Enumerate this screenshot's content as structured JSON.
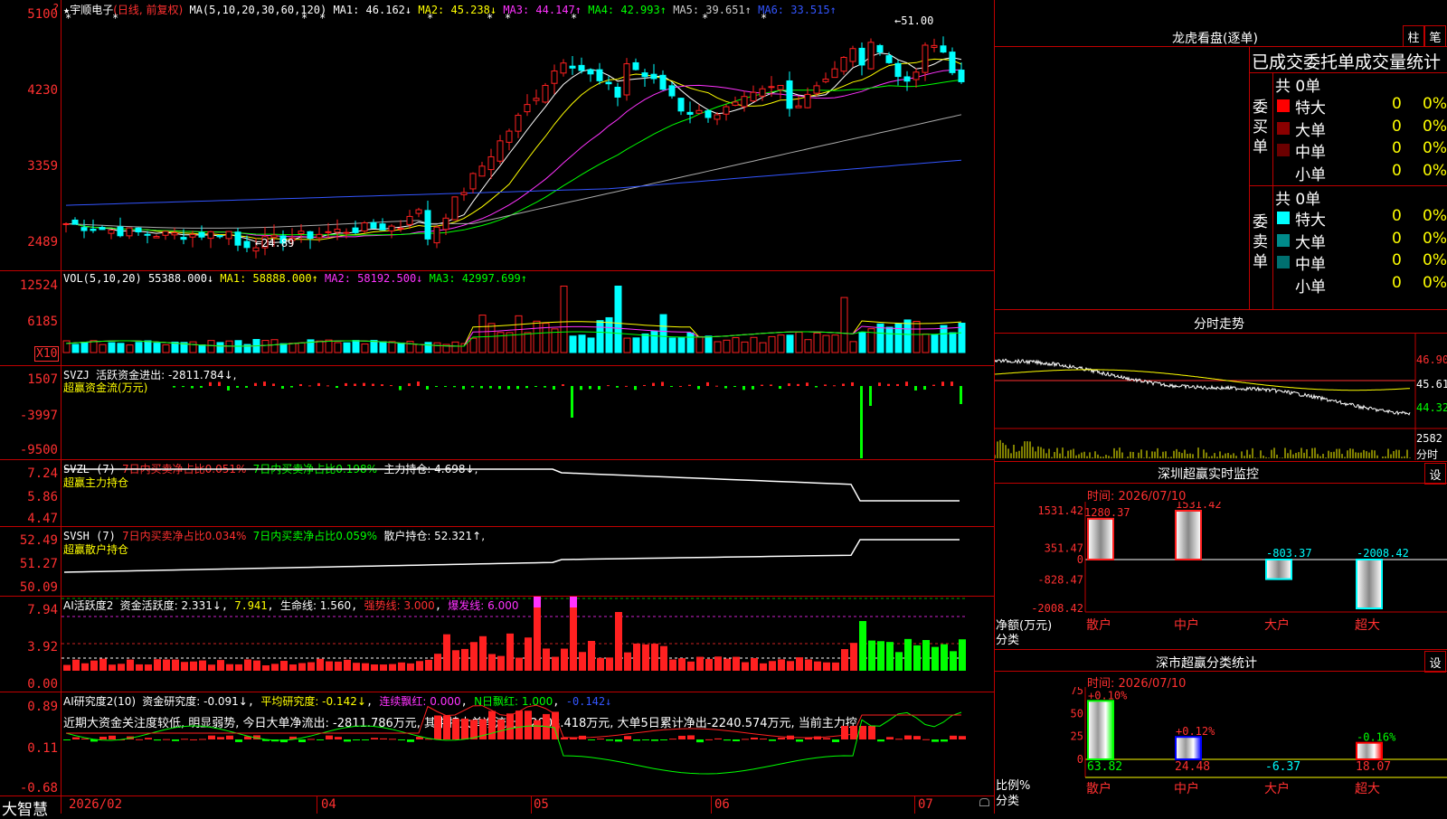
{
  "header": {
    "stock_name": "宇顺电子",
    "period": "(日线, 前复权)",
    "ma_label": "MA(5,10,20,30,60,120)",
    "ma": [
      {
        "label": "MA1: 46.162↓",
        "color": "#ffffff"
      },
      {
        "label": "MA2: 45.238↓",
        "color": "#ffff00"
      },
      {
        "label": "MA3: 44.147↑",
        "color": "#ff33ff"
      },
      {
        "label": "MA4: 42.993↑",
        "color": "#00ff00"
      },
      {
        "label": "MA5: 39.651↑",
        "color": "#aaaaaa"
      },
      {
        "label": "MA6: 33.515↑",
        "color": "#3355ff"
      }
    ],
    "price_axis": [
      "5100",
      "4230",
      "3359",
      "2489"
    ],
    "high_mark": "51.00",
    "low_mark": "24.89"
  },
  "vol": {
    "label": "VOL(5,10,20)",
    "value": "55388.000↓",
    "ma1": "MA1: 58888.000↑",
    "ma2": "MA2: 58192.500↓",
    "ma3": "MA3: 42997.699↑",
    "axis": [
      "12524",
      "6185"
    ],
    "unit": "X10"
  },
  "svzj": {
    "label": "SVZJ",
    "text": "活跃资金进出: -2811.784↓,",
    "sub": "超赢资金流(万元)",
    "axis": [
      "1507",
      "-3997",
      "-9500"
    ]
  },
  "svzl": {
    "label": "SVZL (7)",
    "t1": "7日内买卖净占比0.051%",
    "t2": "7日内买卖净占比0.198%",
    "t3": "主力持仓: 4.698↓,",
    "sub": "超赢主力持仓",
    "axis": [
      "7.24",
      "5.86",
      "4.47"
    ]
  },
  "svsh": {
    "label": "SVSH (7)",
    "t1": "7日内买卖净占比0.034%",
    "t2": "7日内买卖净占比0.059%",
    "t3": "散户持仓: 52.321↑,",
    "sub": "超赢散户持仓",
    "axis": [
      "52.49",
      "51.27",
      "50.09"
    ]
  },
  "ai_active": {
    "label": "AI活跃度2",
    "t1": "资金活跃度: 2.331↓",
    "t2": "7.941",
    "t3": "生命线: 1.560",
    "t4": "强势线: 3.000",
    "t5": "爆发线: 6.000",
    "axis": [
      "7.94",
      "3.92",
      "0.00"
    ]
  },
  "ai_research": {
    "label": "AI研究度2(10)",
    "t1": "资金研究度: -0.091↓",
    "t2": "平均研究度: -0.142↓",
    "t3": "连续飘红: 0.000",
    "t4": "N日飘红: 1.000",
    "t5": "-0.142↓",
    "comment": "近期大资金关注度较低, 明显弱势, 今日大单净流出: -2811.786万元, 其中特大单净流出: -2008.418万元, 大单5日累计净出-2240.574万元, 当前主力控",
    "axis": [
      "0.89",
      "0.11",
      "-0.68"
    ]
  },
  "footer": {
    "brand": "大智慧",
    "dates": [
      "2026/02",
      "04",
      "05",
      "06",
      "07"
    ]
  },
  "right": {
    "lhkp_title": "龙虎看盘(逐单)",
    "btn1": "柱",
    "btn2": "笔",
    "stat_title": "已成交委托单成交量统计",
    "buy_total": "共 0单",
    "buy_label": "委买单",
    "sell_total": "共 0单",
    "sell_label": "委卖单",
    "buy_rows": [
      {
        "name": "特大",
        "val": "0",
        "pct": "0%",
        "color": "#ff0000"
      },
      {
        "name": "大单",
        "val": "0",
        "pct": "0%",
        "color": "#8b0000"
      },
      {
        "name": "中单",
        "val": "0",
        "pct": "0%",
        "color": "#6b0000"
      },
      {
        "name": "小单",
        "val": "0",
        "pct": "0%",
        "color": ""
      }
    ],
    "sell_rows": [
      {
        "name": "特大",
        "val": "0",
        "pct": "0%",
        "color": "#00ffff"
      },
      {
        "name": "大单",
        "val": "0",
        "pct": "0%",
        "color": "#008b8b"
      },
      {
        "name": "中单",
        "val": "0",
        "pct": "0%",
        "color": "#007070"
      },
      {
        "name": "小单",
        "val": "0",
        "pct": "0%",
        "color": ""
      }
    ],
    "fenshi_title": "分时走势",
    "fenshi_axis": [
      "46.90",
      "45.61",
      "44.32"
    ],
    "fenshi_vol": "2582",
    "fenshi_unit": "分时",
    "sz_title": "深圳超赢实时监控",
    "sz_btn": "设",
    "sz_time": "时间: 2026/07/10",
    "sz_axis": [
      "1531.42",
      "351.47",
      "0",
      "-828.47",
      "-2008.42"
    ],
    "sz_ylabel": "净额(万元)",
    "sz_xlabel": "分类",
    "sz_bars": [
      {
        "cat": "散户",
        "value": 1280.37,
        "label": "1280.37"
      },
      {
        "cat": "中户",
        "value": 1531.42,
        "label": "1531.42"
      },
      {
        "cat": "大户",
        "value": -803.37,
        "label": "-803.37"
      },
      {
        "cat": "超大",
        "value": -2008.42,
        "label": "-2008.42"
      }
    ],
    "fl_title": "深市超赢分类统计",
    "fl_btn": "设",
    "fl_time": "时间: 2026/07/10",
    "fl_axis": [
      "75",
      "50",
      "25",
      "0"
    ],
    "fl_ylabel": "比例%",
    "fl_xlabel": "分类",
    "fl_bars": [
      {
        "cat": "散户",
        "value": 63.82,
        "change": "+0.10%",
        "label": "63.82",
        "color": "#00ff00"
      },
      {
        "cat": "中户",
        "value": 24.48,
        "change": "+0.12%",
        "label": "24.48",
        "color": "#0000ff"
      },
      {
        "cat": "大户",
        "value": -6.37,
        "change": "",
        "label": "-6.37",
        "color": "#00ffff"
      },
      {
        "cat": "超大",
        "value": 18.07,
        "change": "-0.16%",
        "label": "18.07",
        "color": "#ff0000"
      }
    ]
  }
}
